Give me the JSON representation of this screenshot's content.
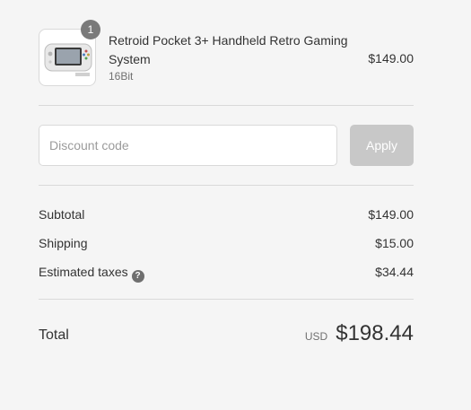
{
  "product": {
    "title": "Retroid Pocket 3+ Handheld Retro Gaming System",
    "variant": "16Bit",
    "price": "$149.00",
    "quantity": "1",
    "image_icon": "handheld-console-icon"
  },
  "discount": {
    "placeholder": "Discount code",
    "apply_label": "Apply"
  },
  "summary": {
    "subtotal_label": "Subtotal",
    "subtotal_value": "$149.00",
    "shipping_label": "Shipping",
    "shipping_value": "$15.00",
    "taxes_label": "Estimated taxes",
    "taxes_help_glyph": "?",
    "taxes_value": "$34.44"
  },
  "total": {
    "label": "Total",
    "currency": "USD",
    "amount": "$198.44"
  },
  "colors": {
    "background": "#f5f5f5",
    "apply_button_disabled": "#c8c8c8",
    "badge": "#7a7a7a",
    "divider": "#d9d9d9"
  }
}
